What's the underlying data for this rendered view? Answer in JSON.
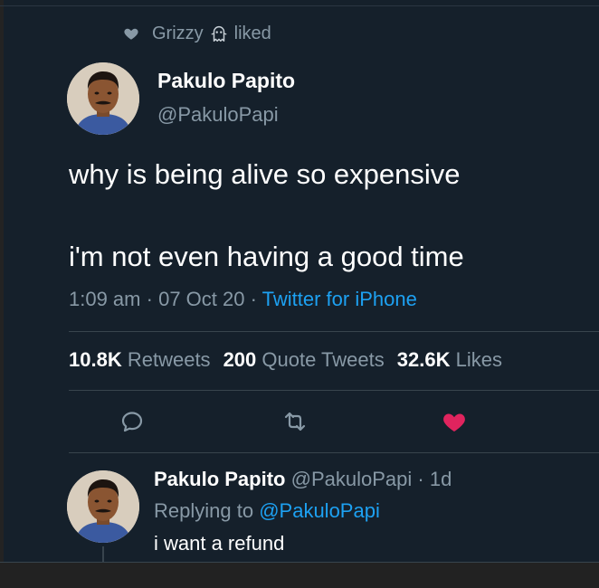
{
  "social_context": {
    "user": "Grizzy",
    "action": "liked",
    "icons": [
      "heart-icon",
      "ghost-emoji-icon"
    ]
  },
  "tweet": {
    "display_name": "Pakulo Papito",
    "handle": "@PakuloPapi",
    "line1": "why is being alive so expensive",
    "line2": "i'm not even having a good time",
    "time": "1:09 am",
    "date": "07 Oct 20",
    "separator": "·",
    "source": "Twitter for iPhone"
  },
  "stats": {
    "retweets_count": "10.8K",
    "retweets_label": "Retweets",
    "quotes_count": "200",
    "quotes_label": "Quote Tweets",
    "likes_count": "32.6K",
    "likes_label": "Likes"
  },
  "actions": {
    "icons": [
      "reply-icon",
      "retweet-icon",
      "like-heart-icon"
    ],
    "liked": true
  },
  "reply": {
    "display_name": "Pakulo Papito",
    "handle": "@PakuloPapi",
    "age": "1d",
    "separator": "·",
    "replying_prefix": "Replying to",
    "replying_to": "@PakuloPapi",
    "text": "i want a refund"
  },
  "colors": {
    "background": "#15202b",
    "text_primary": "#ffffff",
    "text_secondary": "#8899a6",
    "accent_link": "#1da1f2",
    "like_active": "#e0245e",
    "divider": "#38444d"
  }
}
